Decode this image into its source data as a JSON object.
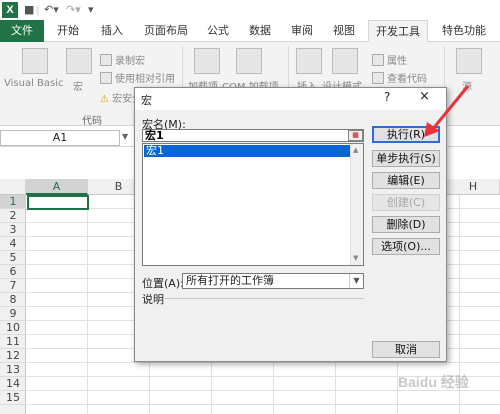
{
  "window": {
    "app_logo": "X",
    "quick_access": [
      "save-icon",
      "undo-icon",
      "redo-icon",
      "customize-icon"
    ]
  },
  "ribbon": {
    "tabs": [
      "文件",
      "开始",
      "插入",
      "页面布局",
      "公式",
      "数据",
      "审阅",
      "视图",
      "开发工具",
      "特色功能"
    ],
    "active_tab": "开发工具",
    "code_group": {
      "visual_basic": "Visual Basic",
      "macros": "宏",
      "record_macro": "录制宏",
      "relative_ref": "使用相对引用",
      "macro_security": "宏安全",
      "label": "代码"
    },
    "addins_group": {
      "addins": "加载项",
      "com_addins": "COM 加载项"
    },
    "controls_group": {
      "insert": "插入",
      "design_mode": "设计模式",
      "properties": "属性",
      "view_code": "查看代码"
    },
    "source_label": "源"
  },
  "formula_bar": {
    "name_box": "A1"
  },
  "grid": {
    "columns": [
      "A",
      "B",
      "H"
    ],
    "rows": [
      "1",
      "2",
      "3",
      "4",
      "5",
      "6",
      "7",
      "8",
      "9",
      "10",
      "11",
      "12",
      "13",
      "14",
      "15"
    ],
    "active_cell": "A1"
  },
  "dialog": {
    "title": "宏",
    "help": "?",
    "close": "×",
    "macro_name_label": "宏名(M):",
    "macro_name_value": "宏1",
    "macro_list": [
      "宏1"
    ],
    "location_label": "位置(A):",
    "location_value": "所有打开的工作簿",
    "description_label": "说明",
    "buttons": {
      "run": "执行(R)",
      "step_into": "单步执行(S)",
      "edit": "编辑(E)",
      "create": "创建(C)",
      "delete": "删除(D)",
      "options": "选项(O)...",
      "cancel": "取消"
    }
  },
  "annotation": {
    "arrow_color": "#e8323c"
  },
  "watermark": "Baidu 经验"
}
